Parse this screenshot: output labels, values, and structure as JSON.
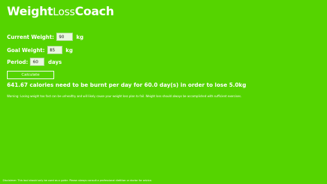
{
  "app": {
    "title_part1": "Weight",
    "title_part2": "Loss",
    "title_part3": "Coach"
  },
  "form": {
    "current_weight_label": "Current Weight:",
    "current_weight_value": "90",
    "current_weight_unit": "kg",
    "goal_weight_label": "Goal Weight:",
    "goal_weight_value": "85",
    "goal_weight_unit": "kg",
    "period_label": "Period:",
    "period_value": "60",
    "period_unit": "days",
    "calculate_label": "Calculate"
  },
  "result": {
    "text": "641.67 calories need to be burnt per day for 60.0 day(s) in order to lose 5.0kg",
    "warning": "Warning: Losing weight too fast can be unhealthy and will likely cause your weight loss plan to fail. Weight loss should always be accomplished with sufficient exercises."
  },
  "footer": {
    "disclaimer": "Disclaimer: This tool should only be used as a guide. Please always consult a professional dietitian or doctor for advice."
  },
  "colors": {
    "background": "#55d400",
    "text": "#ffffff"
  }
}
